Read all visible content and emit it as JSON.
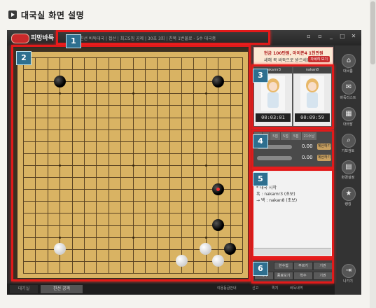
{
  "heading": {
    "text": "대국실 화면 설명"
  },
  "window": {
    "app_name": "피망바둑",
    "game_info": "친선 바둑대국 | 접선 | 최고5집 공제 | 30초 3회 | 친목 1번물로 - 5수 대국중",
    "window_buttons": [
      "▫",
      "▫",
      "_",
      "□",
      "✕"
    ]
  },
  "annotations": [
    "1",
    "2",
    "3",
    "4",
    "5",
    "6"
  ],
  "ad": {
    "line1": "현금 100만원, 아이폰4 1천만원",
    "line2": "새해 복 바둑으로 받으세요!",
    "button": "자세히 보기"
  },
  "players": [
    {
      "name": "nakamr3",
      "time": "00:03:01"
    },
    {
      "name": "nakan8",
      "time": "00:09:59"
    }
  ],
  "score": {
    "tabs": [
      "계",
      "점",
      "5점",
      "5점",
      "5점",
      "21수남"
    ],
    "rows": [
      {
        "value": "0.00",
        "button": "계산하기"
      },
      {
        "value": "0.00",
        "button": "계산하기"
      }
    ]
  },
  "chat": {
    "lines": [
      "* 대국 시작",
      "흑 : nakamr3 (초보)",
      "→ 백 : nakan8 (초보)"
    ]
  },
  "controls": {
    "buttons": [
      "한수쉼",
      "무르기",
      "기권",
      "계가",
      "종료보기",
      "착수",
      "기권"
    ]
  },
  "rail": [
    {
      "icon": "⌂",
      "label": "대국룸"
    },
    {
      "icon": "✉",
      "label": "바둑리스트"
    },
    {
      "icon": "▦",
      "label": "대국장"
    },
    {
      "icon": "⌕",
      "label": "기보검토"
    },
    {
      "icon": "▤",
      "label": "환경설정"
    },
    {
      "icon": "★",
      "label": "랭킹"
    },
    {
      "icon": "⇥",
      "label": "나가기"
    }
  ],
  "status": {
    "tabs": [
      "대기실",
      "친선 공격"
    ],
    "items": [
      "이용등급안내",
      "신고",
      "퀵지",
      "바둑내역"
    ]
  },
  "colors": {
    "highlight": "#e11a1a",
    "badge": "#2e6f8f",
    "board": "#d9b363"
  },
  "board": {
    "size": 19,
    "stones": [
      {
        "x": 3,
        "y": 2,
        "color": "black"
      },
      {
        "x": 16,
        "y": 2,
        "color": "black"
      },
      {
        "x": 16,
        "y": 11,
        "color": "black",
        "last": true
      },
      {
        "x": 16,
        "y": 14,
        "color": "black"
      },
      {
        "x": 17,
        "y": 16,
        "color": "black"
      },
      {
        "x": 3,
        "y": 16,
        "color": "white"
      },
      {
        "x": 15,
        "y": 16,
        "color": "white"
      },
      {
        "x": 13,
        "y": 17,
        "color": "white"
      },
      {
        "x": 16,
        "y": 17,
        "color": "white"
      }
    ]
  }
}
